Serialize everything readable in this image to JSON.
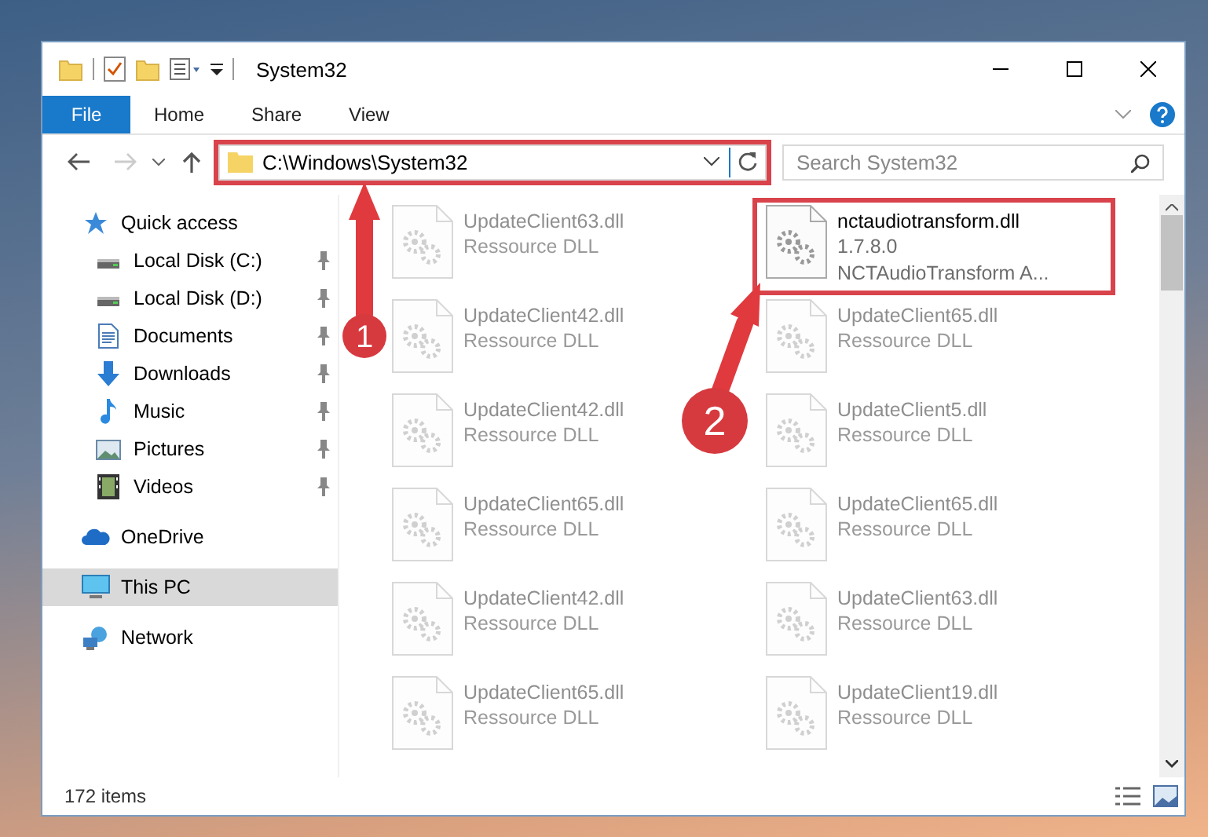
{
  "window": {
    "title": "System32"
  },
  "ribbon_tabs": [
    {
      "label": "File",
      "kind": "file"
    },
    {
      "label": "Home",
      "kind": "tab"
    },
    {
      "label": "Share",
      "kind": "tab"
    },
    {
      "label": "View",
      "kind": "tab"
    }
  ],
  "address_bar": {
    "path": "C:\\Windows\\System32",
    "highlighted": true
  },
  "search": {
    "placeholder": "Search System32"
  },
  "sidebar": {
    "items": [
      {
        "label": "Quick access",
        "kind": "star",
        "selected": false,
        "children": [
          {
            "label": "Local Disk (C:)",
            "kind": "drive",
            "pinned": true,
            "selected": false
          },
          {
            "label": "Local Disk (D:)",
            "kind": "drive",
            "pinned": true,
            "selected": false
          },
          {
            "label": "Documents",
            "kind": "document",
            "pinned": true,
            "selected": false
          },
          {
            "label": "Downloads",
            "kind": "download",
            "pinned": true,
            "selected": false
          },
          {
            "label": "Music",
            "kind": "music",
            "pinned": true,
            "selected": false
          },
          {
            "label": "Pictures",
            "kind": "picture",
            "pinned": true,
            "selected": false
          },
          {
            "label": "Videos",
            "kind": "video",
            "pinned": true,
            "selected": false
          }
        ]
      },
      {
        "label": "OneDrive",
        "kind": "cloud",
        "selected": false
      },
      {
        "label": "This PC",
        "kind": "computer",
        "selected": true
      },
      {
        "label": "Network",
        "kind": "network",
        "selected": false
      }
    ]
  },
  "files": [
    {
      "name": "UpdateClient63.dll",
      "details": [
        "Ressource DLL"
      ],
      "faded": true,
      "highlighted": false
    },
    {
      "name": "nctaudiotransform.dll",
      "details": [
        "1.7.8.0",
        "NCTAudioTransform A..."
      ],
      "faded": false,
      "highlighted": true
    },
    {
      "name": "UpdateClient42.dll",
      "details": [
        "Ressource DLL"
      ],
      "faded": true,
      "highlighted": false
    },
    {
      "name": "UpdateClient65.dll",
      "details": [
        "Ressource DLL"
      ],
      "faded": true,
      "highlighted": false
    },
    {
      "name": "UpdateClient42.dll",
      "details": [
        "Ressource DLL"
      ],
      "faded": true,
      "highlighted": false
    },
    {
      "name": "UpdateClient5.dll",
      "details": [
        "Ressource DLL"
      ],
      "faded": true,
      "highlighted": false
    },
    {
      "name": "UpdateClient65.dll",
      "details": [
        "Ressource DLL"
      ],
      "faded": true,
      "highlighted": false
    },
    {
      "name": "UpdateClient65.dll",
      "details": [
        "Ressource DLL"
      ],
      "faded": true,
      "highlighted": false
    },
    {
      "name": "UpdateClient42.dll",
      "details": [
        "Ressource DLL"
      ],
      "faded": true,
      "highlighted": false
    },
    {
      "name": "UpdateClient63.dll",
      "details": [
        "Ressource DLL"
      ],
      "faded": true,
      "highlighted": false
    },
    {
      "name": "UpdateClient65.dll",
      "details": [
        "Ressource DLL"
      ],
      "faded": true,
      "highlighted": false
    },
    {
      "name": "UpdateClient19.dll",
      "details": [
        "Ressource DLL"
      ],
      "faded": true,
      "highlighted": false
    }
  ],
  "status_bar": {
    "count": "172 items"
  },
  "callouts": [
    {
      "number": "1"
    },
    {
      "number": "2"
    }
  ]
}
